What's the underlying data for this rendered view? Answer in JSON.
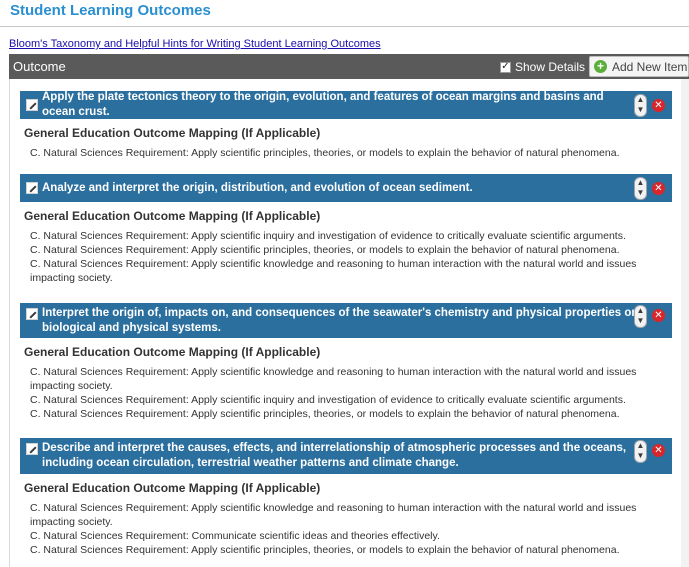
{
  "page": {
    "title": "Student Learning Outcomes",
    "help_link": "Bloom's Taxonomy and Helpful Hints for Writing Student Learning Outcomes"
  },
  "header": {
    "label": "Outcome",
    "show_details_label": "Show Details",
    "show_details_checked": true,
    "add_button_label": "Add New Item"
  },
  "icons": {
    "edit": "edit-icon",
    "move": "move-up-down-icon",
    "delete": "delete-icon",
    "add": "plus-icon"
  },
  "colors": {
    "title": "#2a8fd0",
    "item_header": "#2b6f9e",
    "header_bar": "#5a5a5a",
    "delete": "#d9262b",
    "add": "#5cae3a"
  },
  "mapping_heading": "General Education Outcome Mapping (If Applicable)",
  "outcomes": [
    {
      "title": "Apply the plate tectonics theory to the origin, evolution, and features of ocean margins and basins and ocean crust.",
      "mappings": [
        "C. Natural Sciences Requirement: Apply scientific principles, theories, or models to explain the behavior of natural phenomena."
      ]
    },
    {
      "title": "Analyze and interpret the origin, distribution, and evolution of ocean sediment.",
      "mappings": [
        "C. Natural Sciences Requirement: Apply scientific inquiry and investigation of evidence to critically evaluate scientific arguments.",
        "C. Natural Sciences Requirement: Apply scientific principles, theories, or models to explain the behavior of natural phenomena.",
        "C. Natural Sciences Requirement: Apply scientific knowledge and reasoning to human interaction with the natural world and issues impacting society."
      ]
    },
    {
      "title": "Interpret the origin of, impacts on, and consequences of the seawater's chemistry and physical properties on biological and physical systems.",
      "mappings": [
        "C. Natural Sciences Requirement: Apply scientific knowledge and reasoning to human interaction with the natural world and issues impacting society.",
        "C. Natural Sciences Requirement: Apply scientific inquiry and investigation of evidence to critically evaluate scientific arguments.",
        "C. Natural Sciences Requirement: Apply scientific principles, theories, or models to explain the behavior of natural phenomena."
      ]
    },
    {
      "title": "Describe and interpret the causes, effects, and interrelationship of atmospheric processes and the oceans, including ocean circulation, terrestrial weather patterns and climate change.",
      "mappings": [
        "C. Natural Sciences Requirement: Apply scientific knowledge and reasoning to human interaction with the natural world and issues impacting society.",
        "C. Natural Sciences Requirement: Communicate scientific ideas and theories effectively.",
        "C. Natural Sciences Requirement: Apply scientific principles, theories, or models to explain the behavior of natural phenomena."
      ]
    }
  ]
}
